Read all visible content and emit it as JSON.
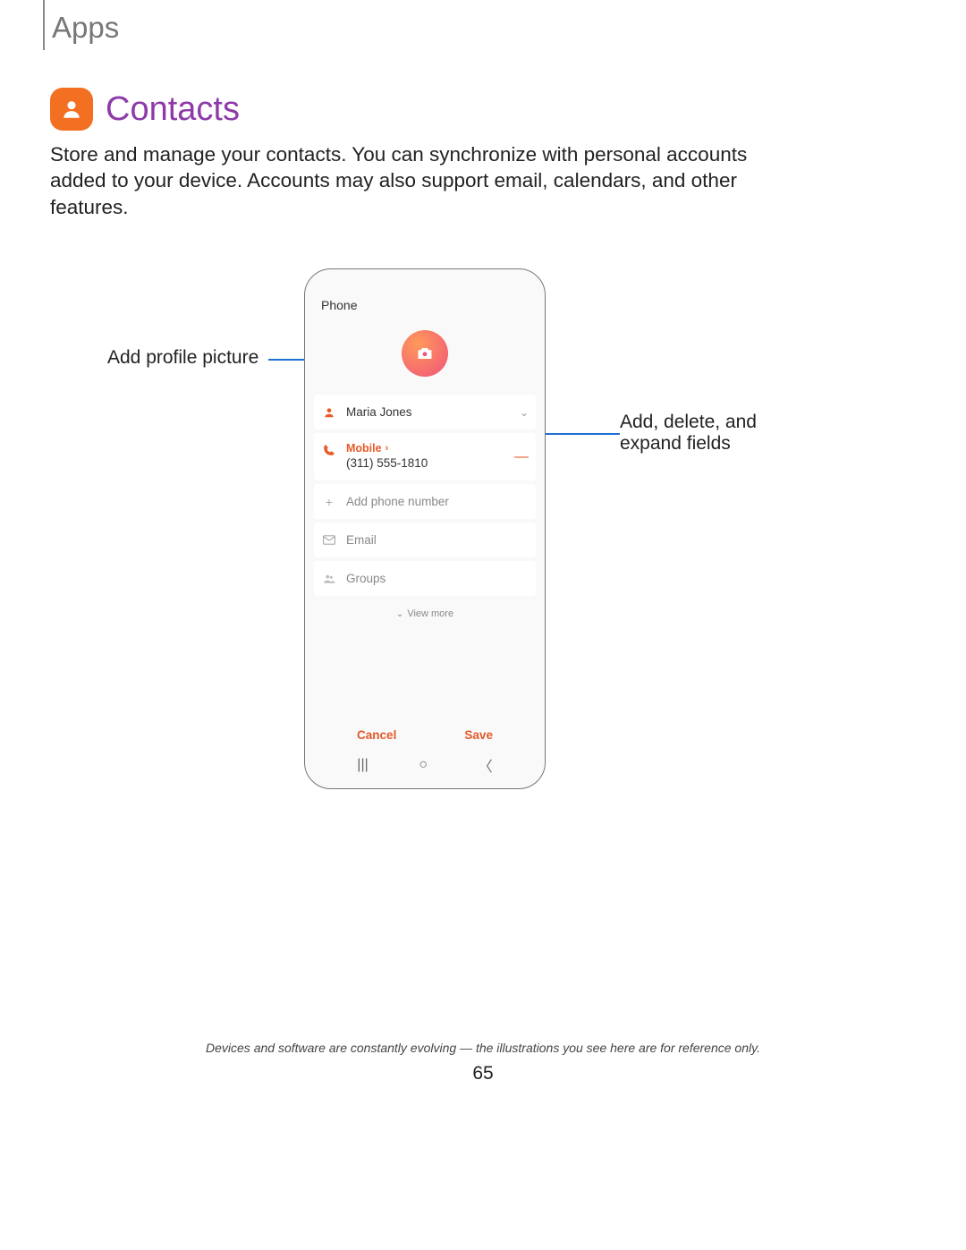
{
  "header": {
    "section": "Apps"
  },
  "title": "Contacts",
  "intro": "Store and manage your contacts. You can synchronize with personal accounts added to your device. Accounts may also support email, calendars, and other features.",
  "callouts": {
    "left": "Add profile picture",
    "right": "Add, delete, and expand fields"
  },
  "phone": {
    "top_label": "Phone",
    "contact_name": "Maria Jones",
    "mobile_label": "Mobile",
    "mobile_number": "(311) 555-1810",
    "add_phone": "Add phone number",
    "email": "Email",
    "groups": "Groups",
    "view_more": "View more",
    "cancel": "Cancel",
    "save": "Save"
  },
  "footnote": "Devices and software are constantly evolving — the illustrations you see here are for reference only.",
  "page_number": "65"
}
